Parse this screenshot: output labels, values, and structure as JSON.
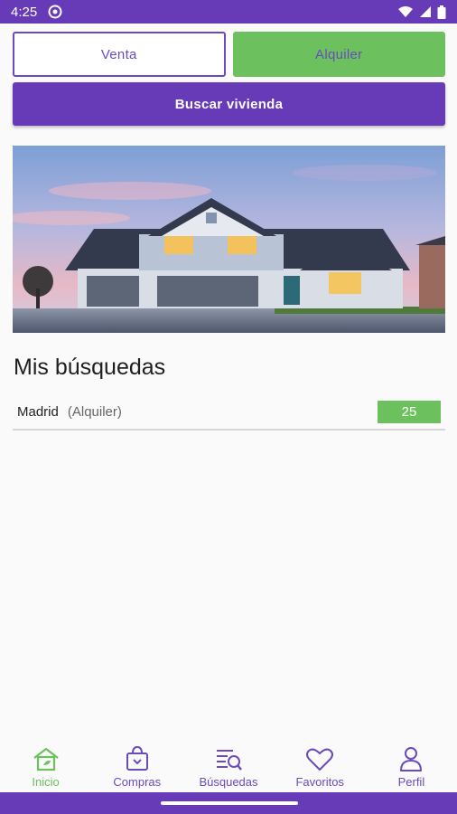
{
  "status_bar": {
    "time": "4:25"
  },
  "toggle": {
    "venta_label": "Venta",
    "alquiler_label": "Alquiler",
    "selected": "Alquiler"
  },
  "search_button": {
    "label": "Buscar vivienda"
  },
  "section": {
    "title": "Mis búsquedas"
  },
  "searches": [
    {
      "city": "Madrid",
      "type": "(Alquiler)",
      "count": "25"
    }
  ],
  "bottom_nav": [
    {
      "label": "Inicio",
      "icon": "home-icon",
      "active": true
    },
    {
      "label": "Compras",
      "icon": "shopping-bag-icon",
      "active": false
    },
    {
      "label": "Búsquedas",
      "icon": "search-list-icon",
      "active": false
    },
    {
      "label": "Favoritos",
      "icon": "heart-icon",
      "active": false
    },
    {
      "label": "Perfil",
      "icon": "person-icon",
      "active": false
    }
  ],
  "colors": {
    "primary": "#673ab7",
    "accent_green": "#6cc15e",
    "background": "#fafafa"
  }
}
